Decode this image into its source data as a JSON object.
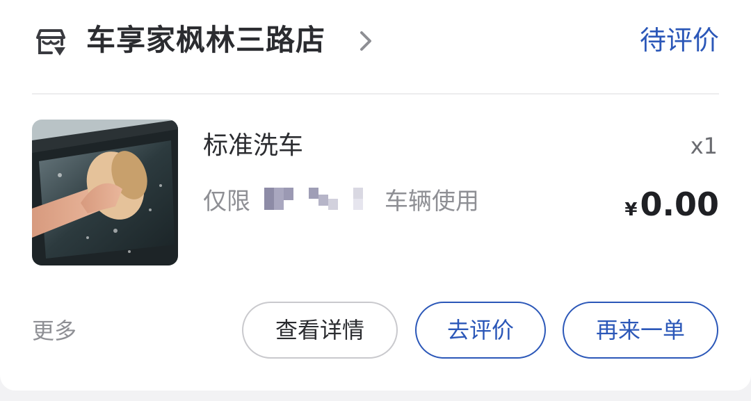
{
  "header": {
    "store_icon": "store-icon",
    "store_name": "车享家枫林三路店",
    "chevron_icon": "chevron-right-icon",
    "status": "待评价"
  },
  "order_item": {
    "image": "car-wash-photo",
    "name": "标准洗车",
    "quantity": "x1",
    "restriction_prefix": "仅限",
    "restriction_suffix": "车辆使用",
    "currency": "¥",
    "price": "0.00"
  },
  "footer": {
    "more_label": "更多",
    "buttons": [
      {
        "label": "查看详情"
      },
      {
        "label": "去评价"
      },
      {
        "label": "再来一单"
      }
    ]
  },
  "colors": {
    "accent": "#2b57b8",
    "text_primary": "#2b2c30",
    "text_secondary": "#8e8f94",
    "background": "#f2f2f4"
  }
}
